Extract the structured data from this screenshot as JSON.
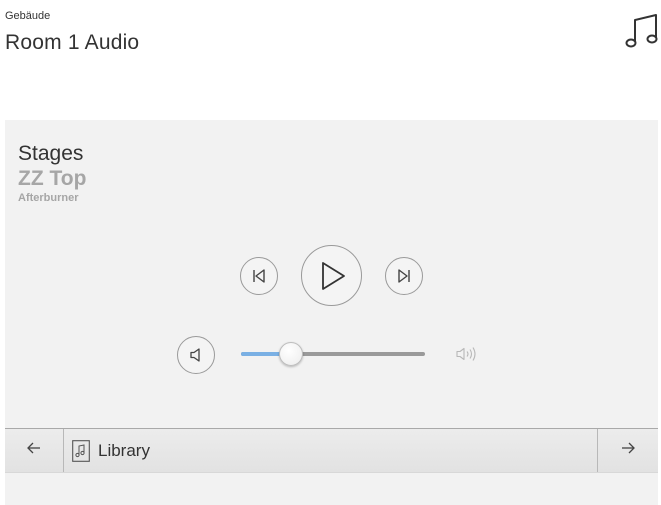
{
  "header": {
    "kicker": "Gebäude",
    "title": "Room 1 Audio",
    "icon": "music-note-icon"
  },
  "now_playing": {
    "title": "Stages",
    "artist": "ZZ Top",
    "album": "Afterburner"
  },
  "controls": {
    "previous_icon": "skip-previous-icon",
    "play_icon": "play-icon",
    "next_icon": "skip-next-icon",
    "mute_icon": "volume-mute-icon",
    "volume_max_icon": "volume-max-icon"
  },
  "volume": {
    "level": 0.25
  },
  "colors": {
    "accent": "#7ab0e4",
    "panel_bg": "#f2f2f2",
    "muted_text": "#a6a6a6"
  },
  "bottom_nav": {
    "back_icon": "arrow-left-icon",
    "forward_icon": "arrow-right-icon",
    "library_icon": "music-file-icon",
    "library_label": "Library"
  }
}
